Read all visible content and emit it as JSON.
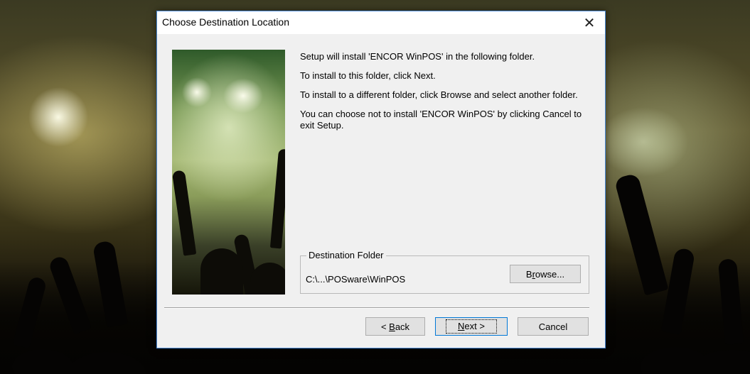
{
  "window": {
    "title": "Choose Destination Location",
    "close_icon": "close-icon"
  },
  "body_text": {
    "line1": "Setup will install 'ENCOR WinPOS' in the following folder.",
    "line2": "To install to this folder, click Next.",
    "line3": "To install to a different folder, click Browse and select another folder.",
    "line4": "You can choose not to install 'ENCOR WinPOS' by clicking Cancel to exit Setup."
  },
  "destination": {
    "group_label": "Destination Folder",
    "path": "C:\\...\\POSware\\WinPOS",
    "browse_label_pre": "B",
    "browse_label_ul": "r",
    "browse_label_post": "owse..."
  },
  "buttons": {
    "back_pre": "< ",
    "back_ul": "B",
    "back_post": "ack",
    "next_ul": "N",
    "next_post": "ext >",
    "cancel": "Cancel"
  },
  "colors": {
    "window_border": "#4a8ad8",
    "dialog_bg": "#f0f0f0",
    "button_bg": "#e1e1e1",
    "default_button_border": "#0078d7"
  }
}
